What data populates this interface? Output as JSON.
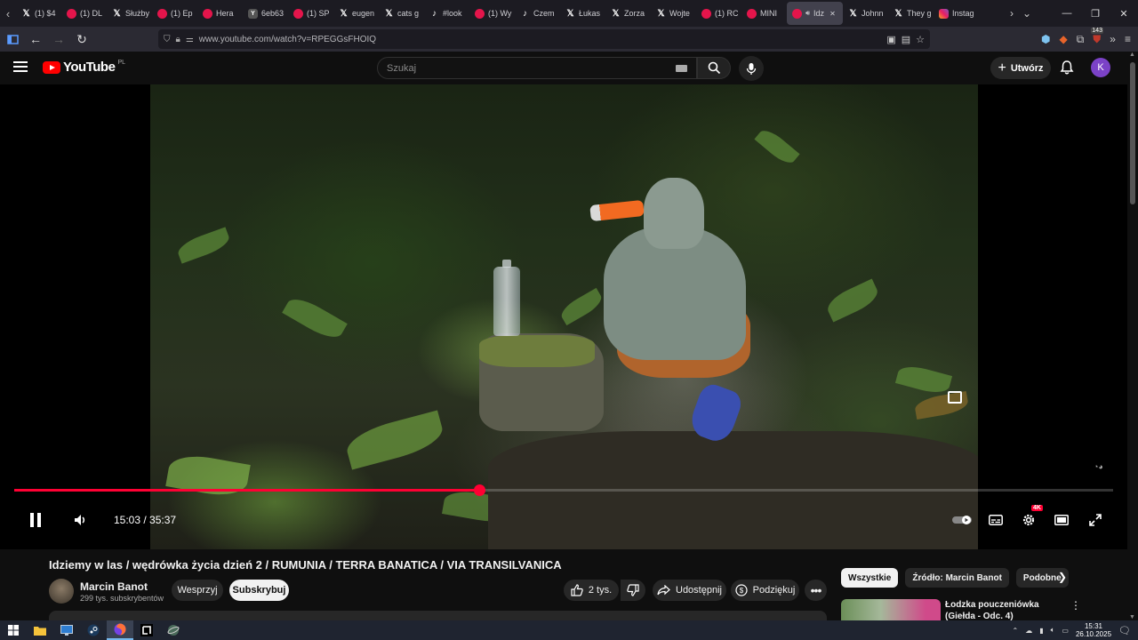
{
  "browser": {
    "tabs": [
      {
        "label": "(1) $4",
        "icon": "x-icon"
      },
      {
        "label": "(1) DL",
        "icon": "youtube-icon"
      },
      {
        "label": "Służby",
        "icon": "x-icon"
      },
      {
        "label": "(1) Ep",
        "icon": "youtube-icon"
      },
      {
        "label": "Hera",
        "icon": "youtube-icon"
      },
      {
        "label": "6eb63",
        "icon": "ycombinator-icon"
      },
      {
        "label": "(1) SP",
        "icon": "youtube-icon"
      },
      {
        "label": "eugen",
        "icon": "x-icon"
      },
      {
        "label": "cats g",
        "icon": "x-icon"
      },
      {
        "label": "#look",
        "icon": "tiktok-icon"
      },
      {
        "label": "(1) Wy",
        "icon": "youtube-icon"
      },
      {
        "label": "Czem",
        "icon": "tiktok-icon"
      },
      {
        "label": "Łukas",
        "icon": "x-icon"
      },
      {
        "label": "Zorza",
        "icon": "x-icon"
      },
      {
        "label": "Wojte",
        "icon": "x-icon"
      },
      {
        "label": "(1) RC",
        "icon": "youtube-icon"
      },
      {
        "label": "MINI",
        "icon": "youtube-icon"
      },
      {
        "label": "Idz",
        "icon": "youtube-icon",
        "active": true
      },
      {
        "label": "Johnn",
        "icon": "x-icon"
      },
      {
        "label": "They g",
        "icon": "x-icon"
      },
      {
        "label": "Instag",
        "icon": "instagram-icon"
      }
    ],
    "url": "www.youtube.com/watch?v=RPEGGsFHOIQ",
    "extension_badge": "143"
  },
  "youtube": {
    "logo_text": "YouTube",
    "logo_country": "PL",
    "search_placeholder": "Szukaj",
    "create_label": "Utwórz",
    "avatar_letter": "K"
  },
  "player": {
    "current_time": "15:03",
    "duration": "35:37",
    "time_display": "15:03 / 35:37",
    "progress_fraction": 0.4228,
    "quality_badge": "4K",
    "state": "playing"
  },
  "video": {
    "title": "Idziemy w las / wędrówka życia dzień 2 / RUMUNIA / TERRA BANATICA / VIA TRANSILVANICA",
    "channel_name": "Marcin Banot",
    "subscribers": "299 tys. subskrybentów",
    "support_label": "Wesprzyj",
    "subscribe_label": "Subskrybuj",
    "likes": "2 tys.",
    "share_label": "Udostępnij",
    "thanks_label": "Podziękuj"
  },
  "sidebar": {
    "chips": [
      "Wszystkie",
      "Źródło: Marcin Banot",
      "Podobne"
    ],
    "active_chip": "Wszystkie",
    "recommendation_title": "Łodzka pouczeniówka (Giełda - Odc. 4)"
  },
  "taskbar": {
    "time": "15:31",
    "date": "26.10.2025"
  },
  "colors": {
    "accent_red": "#ff0033",
    "avatar_purple": "#7b42c7",
    "background": "#0f0f0f"
  }
}
